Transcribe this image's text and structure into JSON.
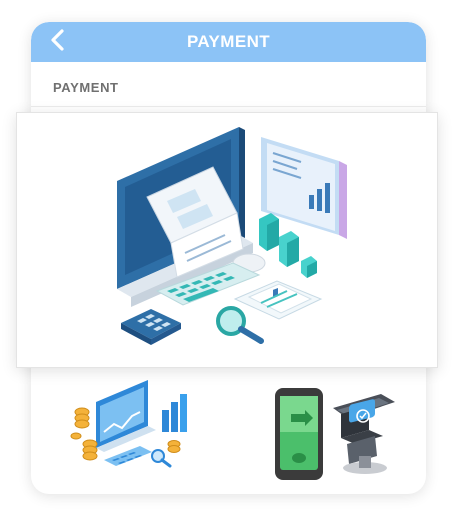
{
  "header": {
    "title": "PAYMENT",
    "back_icon": "chevron-left-icon",
    "background_color": "#8cc3f6"
  },
  "section": {
    "label": "PAYMENT"
  },
  "images": {
    "feature": "payment-desktop-illustration",
    "thumbnails": [
      "online-payment-illustration",
      "pos-terminal-illustration"
    ]
  },
  "colors": {
    "accent_blue": "#2e6fa7",
    "teal": "#35c7c2",
    "coin_gold": "#f4b23a",
    "terminal_green": "#4bbf6b"
  }
}
